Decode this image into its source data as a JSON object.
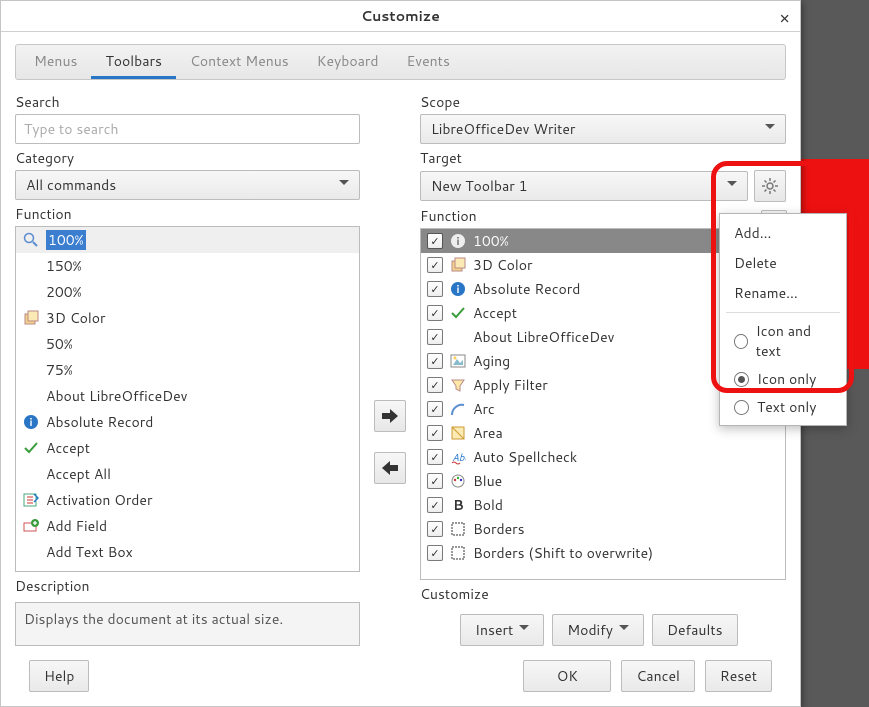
{
  "window": {
    "title": "Customize"
  },
  "tabs": [
    "Menus",
    "Toolbars",
    "Context Menus",
    "Keyboard",
    "Events"
  ],
  "active_tab": 1,
  "left": {
    "search_label": "Search",
    "search_placeholder": "Type to search",
    "category_label": "Category",
    "category_value": "All commands",
    "function_label": "Function",
    "items": [
      {
        "label": "100%",
        "icon": "zoom",
        "selected": true
      },
      {
        "label": "150%",
        "icon": ""
      },
      {
        "label": "200%",
        "icon": ""
      },
      {
        "label": "3D Color",
        "icon": "cube"
      },
      {
        "label": "50%",
        "icon": ""
      },
      {
        "label": "75%",
        "icon": ""
      },
      {
        "label": "About LibreOfficeDev",
        "icon": ""
      },
      {
        "label": "Absolute Record",
        "icon": "info"
      },
      {
        "label": "Accept",
        "icon": "check"
      },
      {
        "label": "Accept All",
        "icon": ""
      },
      {
        "label": "Activation Order",
        "icon": "order"
      },
      {
        "label": "Add Field",
        "icon": "addfield"
      },
      {
        "label": "Add Text Box",
        "icon": ""
      }
    ],
    "description_label": "Description",
    "description": "Displays the document at its actual size."
  },
  "right": {
    "scope_label": "Scope",
    "scope_value": "LibreOfficeDev Writer",
    "target_label": "Target",
    "target_value": "New Toolbar 1",
    "function_label": "Function",
    "items": [
      {
        "label": "100%",
        "icon": "info-inv",
        "checked": true,
        "selected": true
      },
      {
        "label": "3D Color",
        "icon": "cube",
        "checked": true
      },
      {
        "label": "Absolute Record",
        "icon": "info",
        "checked": true
      },
      {
        "label": "Accept",
        "icon": "check",
        "checked": true
      },
      {
        "label": "About LibreOfficeDev",
        "icon": "",
        "checked": true
      },
      {
        "label": "Aging",
        "icon": "pic",
        "checked": true
      },
      {
        "label": "Apply Filter",
        "icon": "filter",
        "checked": true
      },
      {
        "label": "Arc",
        "icon": "arc",
        "checked": true
      },
      {
        "label": "Area",
        "icon": "area",
        "checked": true
      },
      {
        "label": "Auto Spellcheck",
        "icon": "spell",
        "checked": true
      },
      {
        "label": "Blue",
        "icon": "palette",
        "checked": true
      },
      {
        "label": "Bold",
        "icon": "bold",
        "checked": true
      },
      {
        "label": "Borders",
        "icon": "borders",
        "checked": true
      },
      {
        "label": "Borders (Shift to overwrite)",
        "icon": "borders",
        "checked": true
      }
    ],
    "customize_label": "Customize",
    "insert_btn": "Insert",
    "modify_btn": "Modify",
    "defaults_btn": "Defaults"
  },
  "popup": {
    "add": "Add…",
    "delete": "Delete",
    "rename": "Rename…",
    "icon_text": "Icon and text",
    "icon_only": "Icon only",
    "text_only": "Text only",
    "selected": "icon_only"
  },
  "actions": {
    "help": "Help",
    "ok": "OK",
    "cancel": "Cancel",
    "reset": "Reset"
  }
}
